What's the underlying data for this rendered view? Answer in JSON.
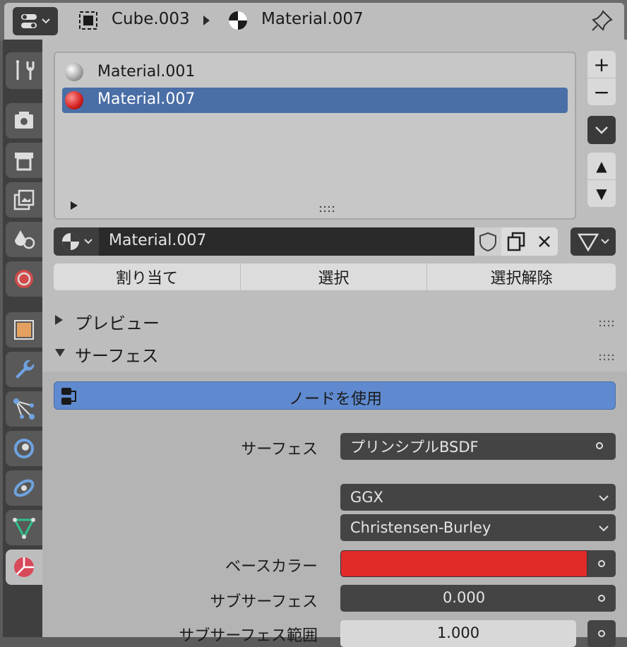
{
  "header": {
    "object_name": "Cube.003",
    "material_name": "Material.007"
  },
  "slots": [
    {
      "name": "Material.001",
      "selected": false
    },
    {
      "name": "Material.007",
      "selected": true
    }
  ],
  "list_controls": {
    "add": "+",
    "remove": "−",
    "up": "▲",
    "down": "▼"
  },
  "material_field": {
    "value": "Material.007"
  },
  "assign_row": {
    "assign": "割り当て",
    "select": "選択",
    "deselect": "選択解除"
  },
  "sections": {
    "preview": "プレビュー",
    "surface": "サーフェス"
  },
  "use_nodes": "ノードを使用",
  "properties": {
    "surface_label": "サーフェス",
    "surface_value": "プリンシプルBSDF",
    "distribution": "GGX",
    "subsurface_method": "Christensen-Burley",
    "base_color_label": "ベースカラー",
    "base_color": "#e12a2a",
    "subsurface_label": "サブサーフェス",
    "subsurface_value": "0.000",
    "subsurface_radius_label": "サブサーフェス範囲",
    "subsurface_radius_value": "1.000"
  },
  "colors": {
    "selection": "#4a6ea6",
    "use_nodes_bg": "#5f8ad0"
  }
}
